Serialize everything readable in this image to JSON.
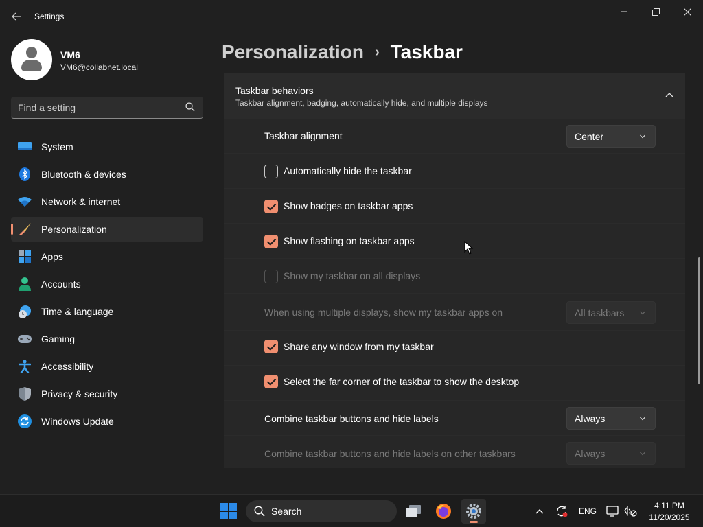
{
  "window": {
    "title": "Settings",
    "back_icon": "arrow-left-icon",
    "controls": [
      "minimize-icon",
      "maximize-icon",
      "close-icon"
    ]
  },
  "profile": {
    "name": "VM6",
    "email": "VM6@collabnet.local"
  },
  "search": {
    "placeholder": "Find a setting",
    "value": ""
  },
  "sidebar": {
    "items": [
      {
        "label": "System",
        "icon": "display-icon"
      },
      {
        "label": "Bluetooth & devices",
        "icon": "bluetooth-icon"
      },
      {
        "label": "Network & internet",
        "icon": "wifi-icon"
      },
      {
        "label": "Personalization",
        "icon": "brush-icon",
        "active": true
      },
      {
        "label": "Apps",
        "icon": "apps-icon"
      },
      {
        "label": "Accounts",
        "icon": "person-icon"
      },
      {
        "label": "Time & language",
        "icon": "clock-globe-icon"
      },
      {
        "label": "Gaming",
        "icon": "gamepad-icon"
      },
      {
        "label": "Accessibility",
        "icon": "accessibility-icon"
      },
      {
        "label": "Privacy & security",
        "icon": "shield-icon"
      },
      {
        "label": "Windows Update",
        "icon": "sync-icon"
      }
    ]
  },
  "breadcrumb": {
    "parent": "Personalization",
    "separator": "›",
    "current": "Taskbar"
  },
  "section": {
    "title": "Taskbar behaviors",
    "subtitle": "Taskbar alignment, badging, automatically hide, and multiple displays",
    "expanded": true,
    "rows": [
      {
        "type": "dropdown",
        "label": "Taskbar alignment",
        "value": "Center",
        "enabled": true
      },
      {
        "type": "checkbox",
        "label": "Automatically hide the taskbar",
        "checked": false,
        "enabled": true
      },
      {
        "type": "checkbox",
        "label": "Show badges on taskbar apps",
        "checked": true,
        "enabled": true
      },
      {
        "type": "checkbox",
        "label": "Show flashing on taskbar apps",
        "checked": true,
        "enabled": true
      },
      {
        "type": "checkbox",
        "label": "Show my taskbar on all displays",
        "checked": false,
        "enabled": false
      },
      {
        "type": "dropdown",
        "label": "When using multiple displays, show my taskbar apps on",
        "value": "All taskbars",
        "enabled": false
      },
      {
        "type": "checkbox",
        "label": "Share any window from my taskbar",
        "checked": true,
        "enabled": true
      },
      {
        "type": "checkbox",
        "label": "Select the far corner of the taskbar to show the desktop",
        "checked": true,
        "enabled": true
      },
      {
        "type": "dropdown",
        "label": "Combine taskbar buttons and hide labels",
        "value": "Always",
        "enabled": true
      },
      {
        "type": "dropdown",
        "label": "Combine taskbar buttons and hide labels on other taskbars",
        "value": "Always",
        "enabled": false
      }
    ]
  },
  "taskbar": {
    "search_label": "Search",
    "apps": [
      "windows-start-icon",
      "task-view-icon",
      "firefox-icon",
      "settings-gear-icon"
    ],
    "tray": {
      "language": "ENG",
      "time": "4:11 PM",
      "date": "11/20/2025"
    }
  },
  "colors": {
    "accent": "#f08f70",
    "background": "#202020",
    "card": "#2b2b2b",
    "start_blue": "#2b8ae8"
  }
}
